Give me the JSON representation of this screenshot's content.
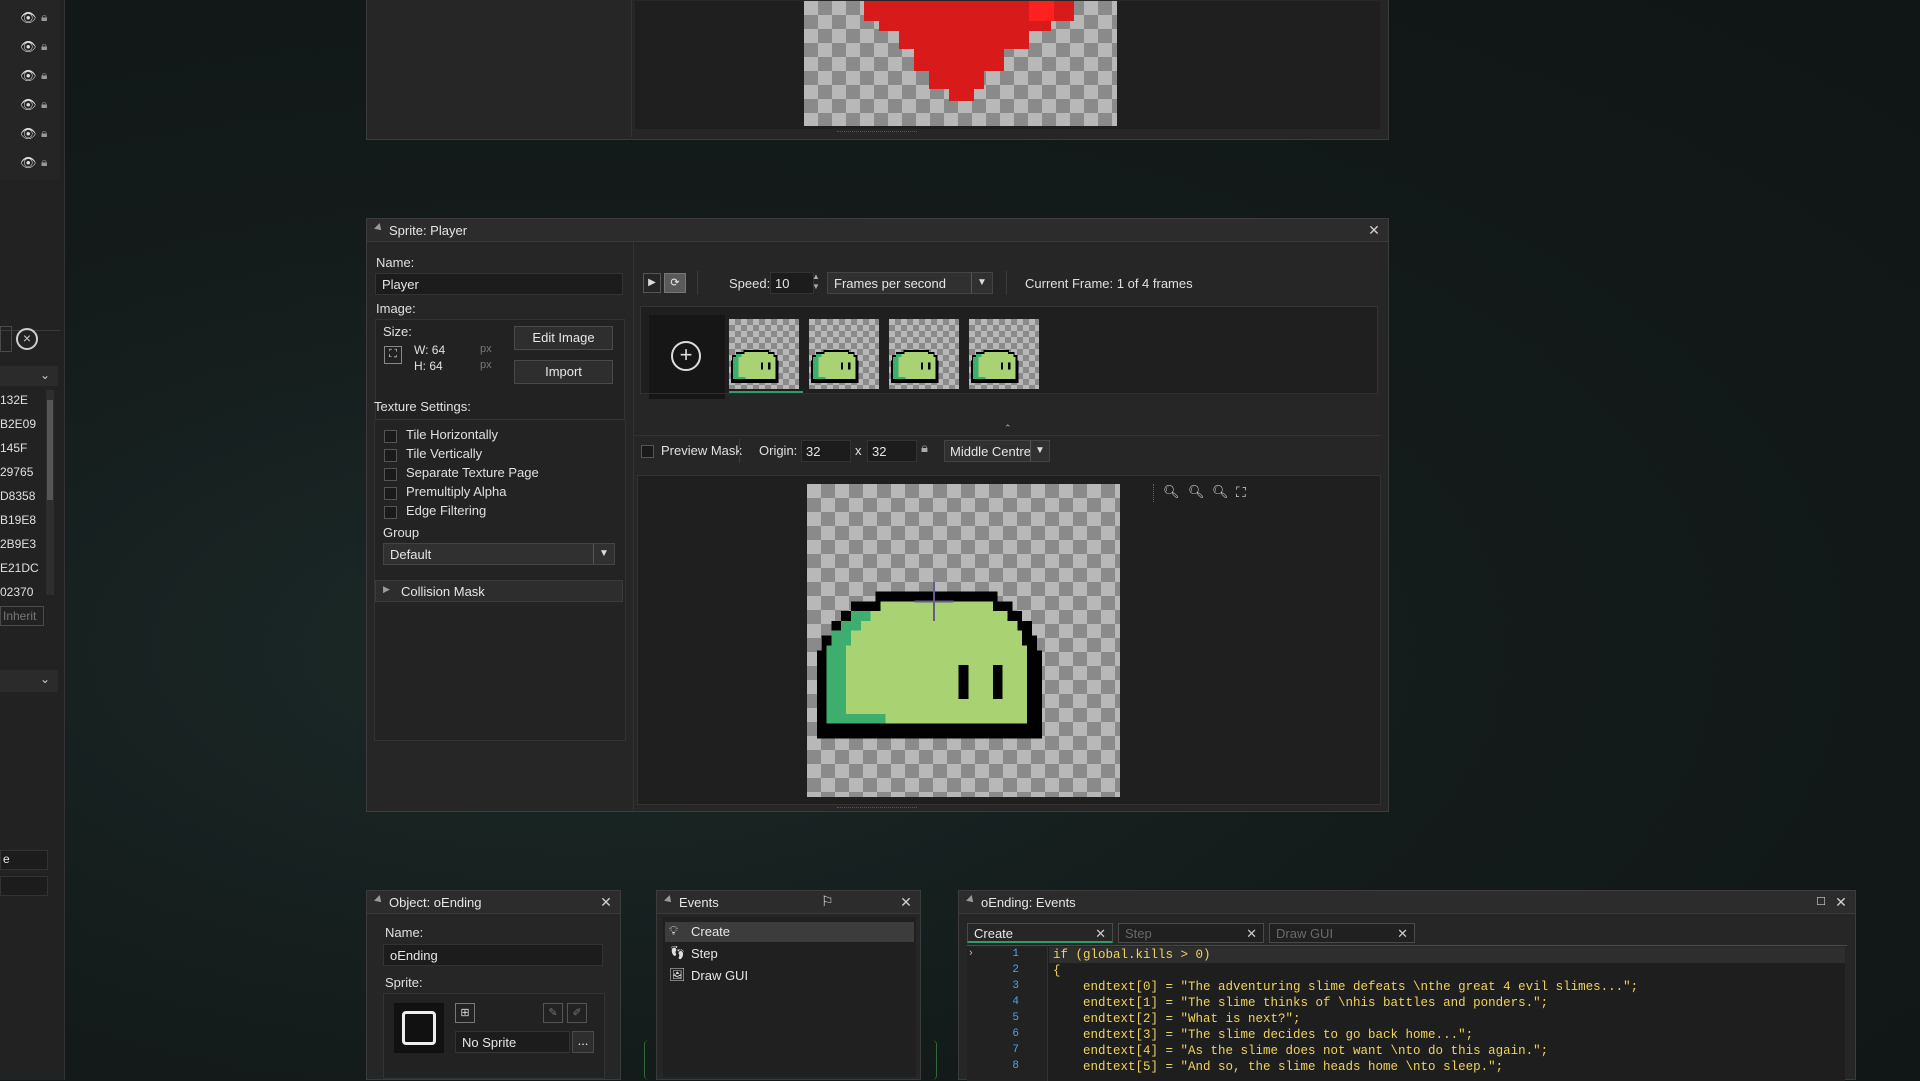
{
  "sidebar": {
    "codes": [
      "132E",
      "B2E09",
      "145F",
      "29765",
      "D8358",
      "B19E8",
      "2B9E3",
      "E21DC",
      "02370"
    ],
    "inherit_label": "Inherit",
    "field1_value": "e"
  },
  "sprite_editor": {
    "title": "Sprite: Player",
    "name_label": "Name:",
    "name_value": "Player",
    "image_label": "Image:",
    "size_label": "Size:",
    "width_text": "W: 64",
    "height_text": "H: 64",
    "px_unit": "px",
    "edit_image_button": "Edit Image",
    "import_button": "Import",
    "texture_settings_label": "Texture Settings:",
    "texture_options": [
      "Tile Horizontally",
      "Tile Vertically",
      "Separate Texture Page",
      "Premultiply Alpha",
      "Edge Filtering"
    ],
    "group_label": "Group",
    "group_value": "Default",
    "collision_mask_label": "Collision Mask",
    "speed_label": "Speed:",
    "speed_value": "10",
    "speed_unit_value": "Frames per second",
    "current_frame_text": "Current Frame: 1 of 4 frames",
    "preview_mask_label": "Preview Mask",
    "origin_label": "Origin:",
    "origin_x": "32",
    "origin_sep": "x",
    "origin_y": "32",
    "origin_preset": "Middle Centre",
    "frame_count": 4
  },
  "object_editor": {
    "title": "Object: oEnding",
    "name_label": "Name:",
    "name_value": "oEnding",
    "sprite_label": "Sprite:",
    "sprite_value": "No Sprite",
    "sprite_more": "..."
  },
  "events_panel": {
    "title": "Events",
    "items": [
      {
        "label": "Create",
        "icon": "lightbulb-icon"
      },
      {
        "label": "Step",
        "icon": "footsteps-icon"
      },
      {
        "label": "Draw GUI",
        "icon": "image-icon"
      }
    ]
  },
  "code_editor": {
    "title": "oEnding: Events",
    "tabs": [
      "Create",
      "Step",
      "Draw GUI"
    ],
    "lines": [
      {
        "n": "1",
        "text": "if (global.kills > 0)"
      },
      {
        "n": "2",
        "text": "{"
      },
      {
        "n": "3",
        "text": "    endtext[0] = \"The adventuring slime defeats \\nthe great 4 evil slimes...\";"
      },
      {
        "n": "4",
        "text": "    endtext[1] = \"The slime thinks of \\nhis battles and ponders.\";"
      },
      {
        "n": "5",
        "text": "    endtext[2] = \"What is next?\";"
      },
      {
        "n": "6",
        "text": "    endtext[3] = \"The slime decides to go back home...\";"
      },
      {
        "n": "7",
        "text": "    endtext[4] = \"As the slime does not want \\nto do this again.\";"
      },
      {
        "n": "8",
        "text": "    endtext[5] = \"And so, the slime heads home \\nto sleep.\";"
      }
    ]
  },
  "colors": {
    "accent_green": "#2f9c6a",
    "heart_red": "#d81a1a",
    "slime_light": "#a9d372",
    "slime_dark": "#3dae6e",
    "link_blue": "#4aa3ff",
    "code_yellow": "#f2d35b"
  }
}
